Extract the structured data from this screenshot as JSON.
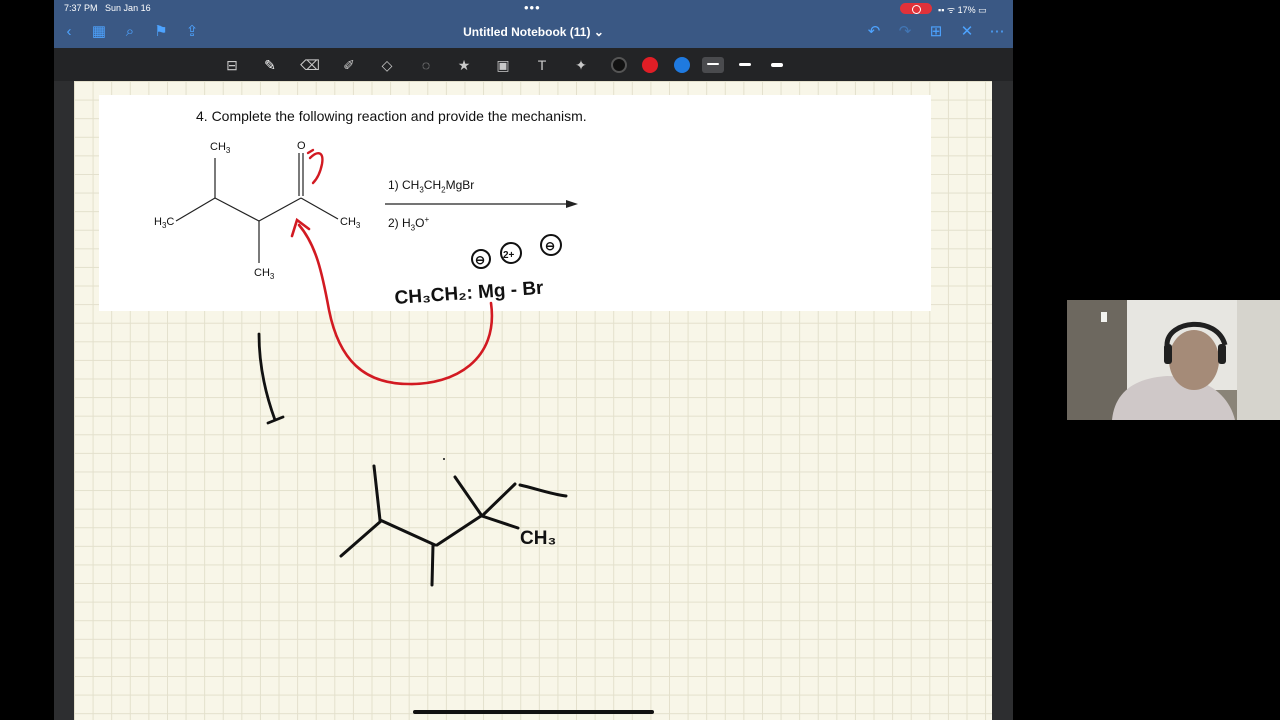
{
  "status_bar": {
    "time": "7:37 PM",
    "date": "Sun Jan 16",
    "battery": "17%"
  },
  "nav_bar": {
    "title": "Untitled Notebook (11)",
    "title_chevron": "⌄"
  },
  "toolbar": {
    "colors": [
      "#111111",
      "#e01e26",
      "#1f7ae0"
    ],
    "selected_stroke": 0
  },
  "question": {
    "text": "4. Complete the following reaction and provide the mechanism."
  },
  "reactant": {
    "ch3_top": "CH",
    "ch3_top_sub": "3",
    "h3c_left_pre": "H",
    "h3c_left_sub": "3",
    "h3c_left_post": "C",
    "ch3_right": "CH",
    "ch3_right_sub": "3",
    "ch3_bottom": "CH",
    "ch3_bottom_sub": "3",
    "oxygen": "O"
  },
  "reagents": {
    "step1_prefix": "1) CH",
    "step1_sub1": "3",
    "step1_mid": "CH",
    "step1_sub2": "2",
    "step1_suffix": "MgBr",
    "step2_prefix": "2) H",
    "step2_sub": "3",
    "step2_mid": "O",
    "step2_sup": "+"
  },
  "handwriting": {
    "grignard": "CH₃CH₂: Mg - Br",
    "charges": [
      "⊖",
      "2+",
      "⊖"
    ],
    "product_label": "CH₃"
  },
  "colors": {
    "nav_blue": "#3a5884",
    "accent": "#4da3ff",
    "ink_red": "#d21a22",
    "ink_black": "#111111",
    "paper": "#f8f6e8"
  }
}
